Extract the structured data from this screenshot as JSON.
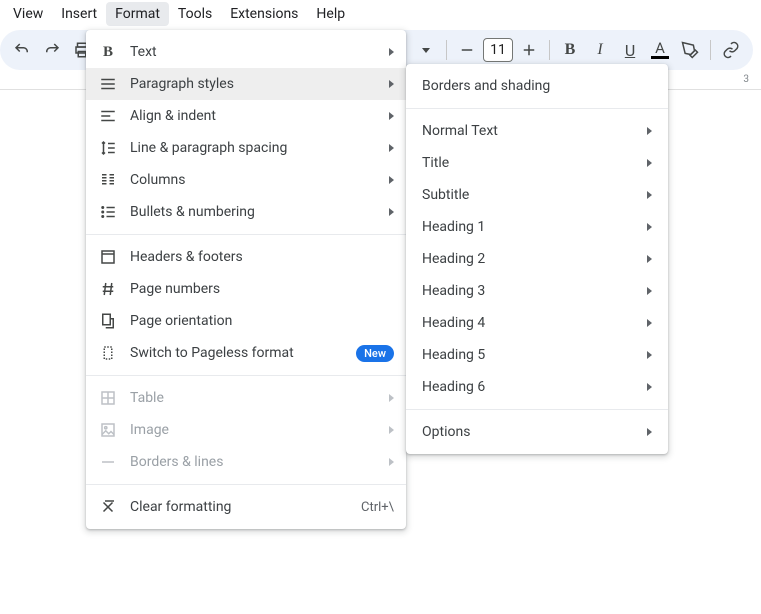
{
  "menubar": {
    "items": [
      "View",
      "Insert",
      "Format",
      "Tools",
      "Extensions",
      "Help"
    ],
    "active_index": 2
  },
  "toolbar": {
    "font_size": "11"
  },
  "ruler": {
    "label_right": "3"
  },
  "format_menu": {
    "groups": [
      [
        {
          "icon": "bold",
          "label": "Text",
          "arrow": true
        },
        {
          "icon": "paragraph",
          "label": "Paragraph styles",
          "arrow": true,
          "hovered": true
        },
        {
          "icon": "align",
          "label": "Align & indent",
          "arrow": true
        },
        {
          "icon": "linespacing",
          "label": "Line & paragraph spacing",
          "arrow": true
        },
        {
          "icon": "columns",
          "label": "Columns",
          "arrow": true
        },
        {
          "icon": "bullets",
          "label": "Bullets & numbering",
          "arrow": true
        }
      ],
      [
        {
          "icon": "headers",
          "label": "Headers & footers"
        },
        {
          "icon": "pagenum",
          "label": "Page numbers"
        },
        {
          "icon": "orientation",
          "label": "Page orientation"
        },
        {
          "icon": "pageless",
          "label": "Switch to Pageless format",
          "badge": "New"
        }
      ],
      [
        {
          "icon": "table",
          "label": "Table",
          "arrow": true,
          "disabled": true
        },
        {
          "icon": "image",
          "label": "Image",
          "arrow": true,
          "disabled": true
        },
        {
          "icon": "borders",
          "label": "Borders & lines",
          "arrow": true,
          "disabled": true
        }
      ],
      [
        {
          "icon": "clear",
          "label": "Clear formatting",
          "shortcut": "Ctrl+\\"
        }
      ]
    ]
  },
  "paragraph_submenu": {
    "groups": [
      [
        {
          "label": "Borders and shading"
        }
      ],
      [
        {
          "label": "Normal Text",
          "arrow": true
        },
        {
          "label": "Title",
          "arrow": true
        },
        {
          "label": "Subtitle",
          "arrow": true
        },
        {
          "label": "Heading 1",
          "arrow": true
        },
        {
          "label": "Heading 2",
          "arrow": true
        },
        {
          "label": "Heading 3",
          "arrow": true
        },
        {
          "label": "Heading 4",
          "arrow": true
        },
        {
          "label": "Heading 5",
          "arrow": true
        },
        {
          "label": "Heading 6",
          "arrow": true
        }
      ],
      [
        {
          "label": "Options",
          "arrow": true
        }
      ]
    ]
  }
}
